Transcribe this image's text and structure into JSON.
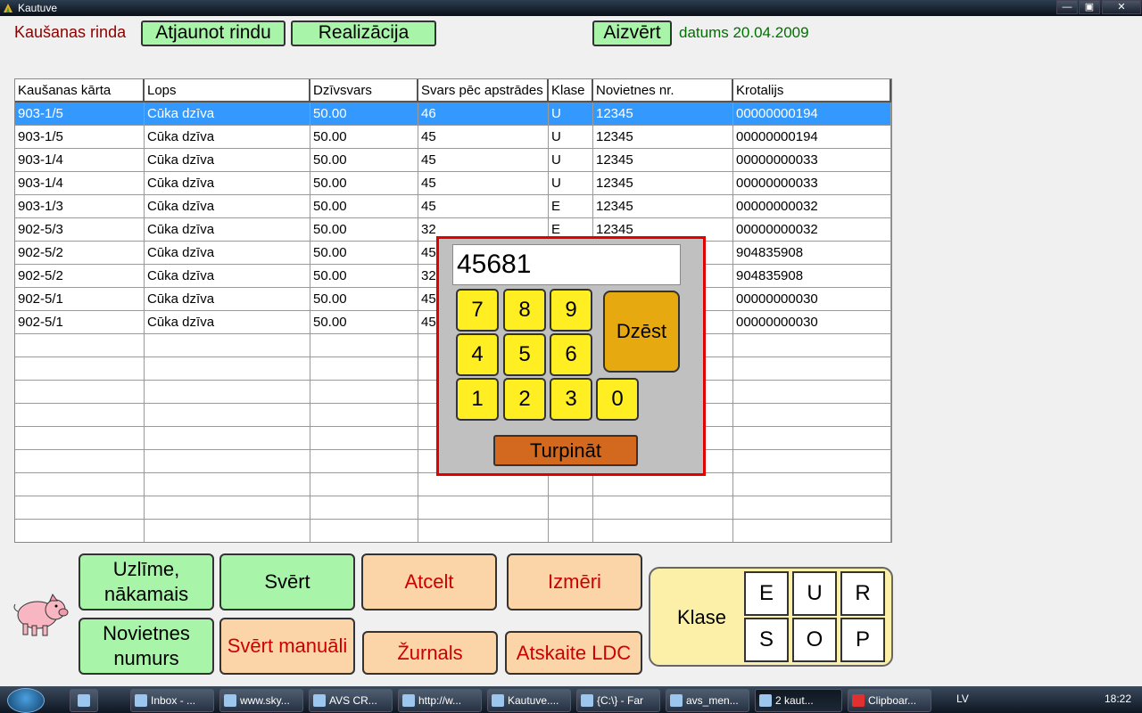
{
  "window": {
    "title": "Kautuve",
    "controls": {
      "minimize": "—",
      "maximize": "▣",
      "close": "✕"
    }
  },
  "top": {
    "label": "Kaušanas rinda",
    "refresh_label": "Atjaunot rindu",
    "realize_label": "Realizācija",
    "close_label": "Aizvērt",
    "date_text": "datums 20.04.2009"
  },
  "table": {
    "columns": [
      "Kaušanas kārta",
      "Lops",
      "Dzīvsvars",
      "Svars pēc apstrādes",
      "Klase",
      "Novietnes nr.",
      "Krotalijs"
    ],
    "rows": [
      [
        "903-1/5",
        "Cūka dzīva",
        "50.00",
        "46",
        "U",
        "12345",
        "00000000194"
      ],
      [
        "903-1/5",
        "Cūka dzīva",
        "50.00",
        "45",
        "U",
        "12345",
        "00000000194"
      ],
      [
        "903-1/4",
        "Cūka dzīva",
        "50.00",
        "45",
        "U",
        "12345",
        "00000000033"
      ],
      [
        "903-1/4",
        "Cūka dzīva",
        "50.00",
        "45",
        "U",
        "12345",
        "00000000033"
      ],
      [
        "903-1/3",
        "Cūka dzīva",
        "50.00",
        "45",
        "E",
        "12345",
        "00000000032"
      ],
      [
        "902-5/3",
        "Cūka dzīva",
        "50.00",
        "32",
        "E",
        "12345",
        "00000000032"
      ],
      [
        "902-5/2",
        "Cūka dzīva",
        "50.00",
        "45",
        "",
        "",
        "904835908"
      ],
      [
        "902-5/2",
        "Cūka dzīva",
        "50.00",
        "32",
        "",
        "",
        "904835908"
      ],
      [
        "902-5/1",
        "Cūka dzīva",
        "50.00",
        "45",
        "",
        "",
        "00000000030"
      ],
      [
        "902-5/1",
        "Cūka dzīva",
        "50.00",
        "45",
        "",
        "",
        "00000000030"
      ]
    ],
    "selected_row": 0
  },
  "numpad": {
    "value": "45681",
    "keys": [
      "7",
      "8",
      "9",
      "4",
      "5",
      "6",
      "1",
      "2",
      "3",
      "0"
    ],
    "delete_label": "Dzēst",
    "continue_label": "Turpināt"
  },
  "buttons": {
    "label_next": "Uzlīme, nākamais",
    "weigh": "Svērt",
    "cancel": "Atcelt",
    "dimensions": "Izmēri",
    "farm_number": "Novietnes numurs",
    "weigh_manual": "Svērt manuāli",
    "journal": "Žurnals",
    "report_ldc": "Atskaite LDC"
  },
  "klase": {
    "label": "Klase",
    "options": [
      "E",
      "U",
      "R",
      "S",
      "O",
      "P"
    ]
  },
  "taskbar": {
    "items": [
      "Inbox - ...",
      "www.sky...",
      "AVS CR...",
      "http://w...",
      "Kautuve....",
      "{C:\\} - Far",
      "avs_men...",
      "2 kaut...",
      "Clipboar..."
    ],
    "active_index": 7,
    "language": "LV",
    "clock": "18:22"
  },
  "colors": {
    "selected_row": "#3399ff",
    "popup_border": "#e00000",
    "key_yellow": "#ffee22"
  }
}
